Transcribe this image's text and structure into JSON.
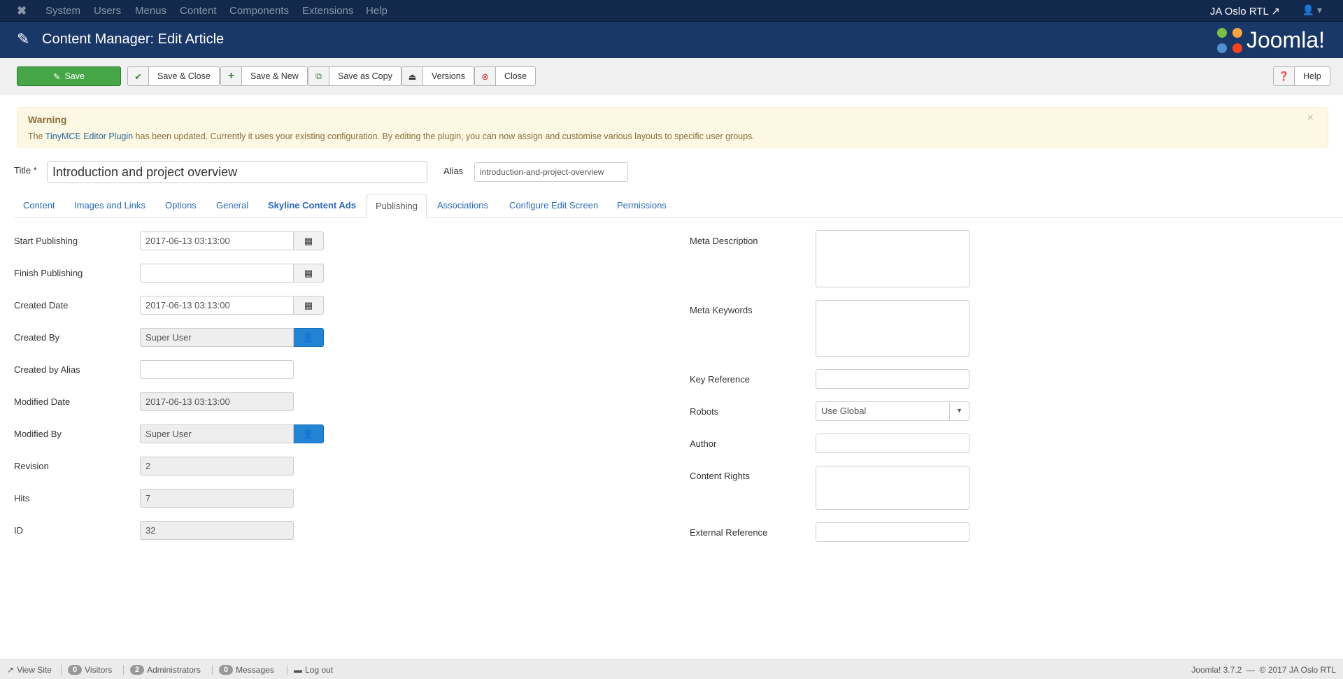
{
  "nav": {
    "items": [
      "System",
      "Users",
      "Menus",
      "Content",
      "Components",
      "Extensions",
      "Help"
    ],
    "site_link": "JA Oslo RTL"
  },
  "header": {
    "title": "Content Manager: Edit Article",
    "logo_text": "Joomla!"
  },
  "toolbar": {
    "save": "Save",
    "save_close": "Save & Close",
    "save_new": "Save & New",
    "save_copy": "Save as Copy",
    "versions": "Versions",
    "close": "Close",
    "help": "Help"
  },
  "warning": {
    "heading": "Warning",
    "before": "The ",
    "link": "TinyMCE Editor Plugin",
    "after": " has been updated. Currently it uses your existing configuration. By editing the plugin, you can now assign and customise various layouts to specific user groups."
  },
  "title_field": {
    "label": "Title *",
    "value": "Introduction and project overview"
  },
  "alias_field": {
    "label": "Alias",
    "value": "introduction-and-project-overview"
  },
  "tabs": [
    "Content",
    "Images and Links",
    "Options",
    "General",
    "Skyline Content Ads",
    "Publishing",
    "Associations",
    "Configure Edit Screen",
    "Permissions"
  ],
  "active_tab": "Publishing",
  "left": {
    "start_publishing": {
      "label": "Start Publishing",
      "value": "2017-06-13 03:13:00"
    },
    "finish_publishing": {
      "label": "Finish Publishing",
      "value": ""
    },
    "created_date": {
      "label": "Created Date",
      "value": "2017-06-13 03:13:00"
    },
    "created_by": {
      "label": "Created By",
      "value": "Super User"
    },
    "created_by_alias": {
      "label": "Created by Alias",
      "value": ""
    },
    "modified_date": {
      "label": "Modified Date",
      "value": "2017-06-13 03:13:00"
    },
    "modified_by": {
      "label": "Modified By",
      "value": "Super User"
    },
    "revision": {
      "label": "Revision",
      "value": "2"
    },
    "hits": {
      "label": "Hits",
      "value": "7"
    },
    "id": {
      "label": "ID",
      "value": "32"
    }
  },
  "right": {
    "meta_description": {
      "label": "Meta Description",
      "value": ""
    },
    "meta_keywords": {
      "label": "Meta Keywords",
      "value": ""
    },
    "key_reference": {
      "label": "Key Reference",
      "value": ""
    },
    "robots": {
      "label": "Robots",
      "value": "Use Global"
    },
    "author": {
      "label": "Author",
      "value": ""
    },
    "content_rights": {
      "label": "Content Rights",
      "value": ""
    },
    "external_reference": {
      "label": "External Reference",
      "value": ""
    }
  },
  "footer": {
    "view_site": "View Site",
    "visitors_count": "0",
    "visitors": "Visitors",
    "admins_count": "2",
    "admins": "Administrators",
    "messages_count": "0",
    "messages": "Messages",
    "logout": "Log out",
    "version": "Joomla! 3.7.2  —  © 2017 JA Oslo RTL"
  }
}
